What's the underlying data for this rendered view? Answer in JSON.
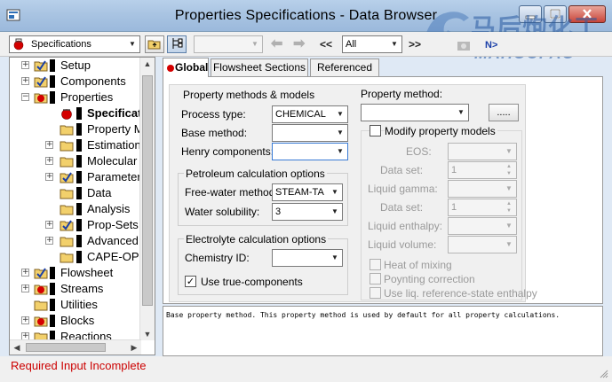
{
  "window": {
    "title": "Properties Specifications - Data Browser"
  },
  "watermark": {
    "text_cn": "马后炮化工",
    "text_en": "MAHOUPAO"
  },
  "toolbar": {
    "form_select": "Specifications",
    "nav_prev_label": "<<",
    "filter_select": "All",
    "nav_next_label": ">>",
    "np_label": "N>"
  },
  "tree": {
    "items": [
      {
        "label": "Setup"
      },
      {
        "label": "Components"
      },
      {
        "label": "Properties"
      },
      {
        "label": "Specificat"
      },
      {
        "label": "Property M"
      },
      {
        "label": "Estimation"
      },
      {
        "label": "Molecular"
      },
      {
        "label": "Parameter"
      },
      {
        "label": "Data"
      },
      {
        "label": "Analysis"
      },
      {
        "label": "Prop-Sets"
      },
      {
        "label": "Advanced"
      },
      {
        "label": "CAPE-OPE"
      },
      {
        "label": "Flowsheet"
      },
      {
        "label": "Streams"
      },
      {
        "label": "Utilities"
      },
      {
        "label": "Blocks"
      },
      {
        "label": "Reactions"
      }
    ]
  },
  "tabs": [
    {
      "label": "Global"
    },
    {
      "label": "Flowsheet Sections"
    },
    {
      "label": "Referenced"
    }
  ],
  "form": {
    "methods_title": "Property methods & models",
    "process_type_label": "Process type:",
    "process_type_value": "CHEMICAL",
    "base_method_label": "Base method:",
    "base_method_value": "",
    "henry_label": "Henry components:",
    "henry_value": "",
    "petroleum_title": "Petroleum calculation options",
    "free_water_label": "Free-water method:",
    "free_water_value": "STEAM-TA",
    "water_solubility_label": "Water solubility:",
    "water_solubility_value": "3",
    "electrolyte_title": "Electrolyte calculation options",
    "chemistry_label": "Chemistry ID:",
    "chemistry_value": "",
    "true_components_label": "Use true-components",
    "true_components_checked": true,
    "property_method_label": "Property method:",
    "property_method_value": "",
    "ellipsis_label": ".....",
    "modify_label": "Modify property models",
    "eos_label": "EOS:",
    "dataset1_label": "Data set:",
    "dataset1_value": "1",
    "liquid_gamma_label": "Liquid gamma:",
    "dataset2_label": "Data set:",
    "dataset2_value": "1",
    "liquid_enthalpy_label": "Liquid enthalpy:",
    "liquid_volume_label": "Liquid volume:",
    "heat_mixing_label": "Heat of mixing",
    "poynting_label": "Poynting correction",
    "liq_ref_label": "Use liq. reference-state enthalpy"
  },
  "description": "Base property method. This property method is used by default for all property calculations.",
  "status": {
    "message": "Required Input Incomplete"
  },
  "colors": {
    "status_error": "#cc0000",
    "accent": "#cc0000",
    "check_blue": "#1a3fa8"
  }
}
